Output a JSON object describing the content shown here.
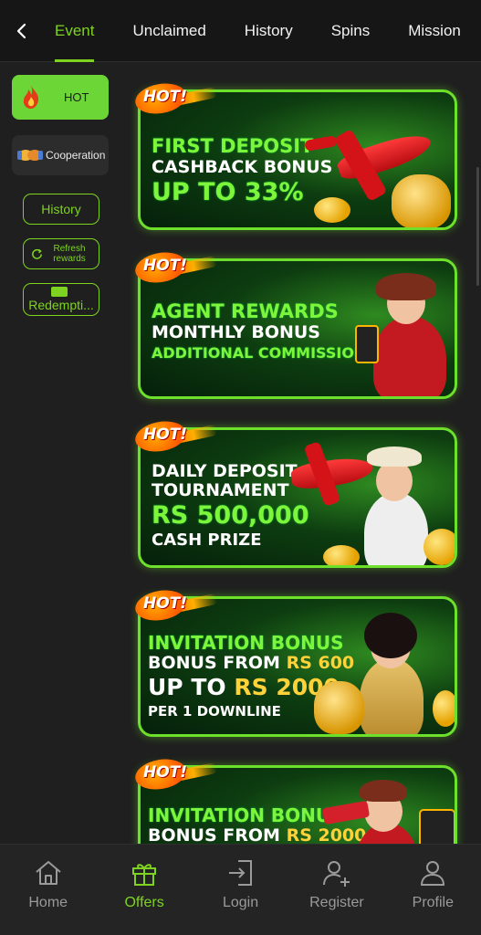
{
  "topbar": {
    "tabs": [
      {
        "label": "Event",
        "active": true
      },
      {
        "label": "Unclaimed",
        "active": false
      },
      {
        "label": "History",
        "active": false
      },
      {
        "label": "Spins",
        "active": false
      },
      {
        "label": "Mission",
        "active": false
      }
    ]
  },
  "sidebar": {
    "hot_label": "HOT",
    "cooperation_label": "Cooperation",
    "history_label": "History",
    "refresh_label": "Refresh rewards",
    "refresh_line1": "Refresh",
    "refresh_line2": "rewards",
    "redemption_label": "Redempti..."
  },
  "banners": [
    {
      "badge": "HOT!",
      "lines": [
        "FIRST DEPOSIT",
        "CASHBACK BONUS",
        "UP TO 33%"
      ]
    },
    {
      "badge": "HOT!",
      "lines": [
        "AGENT REWARDS",
        "MONTHLY BONUS",
        "ADDITIONAL COMMISSIONS"
      ]
    },
    {
      "badge": "HOT!",
      "lines": [
        "DAILY DEPOSIT",
        "TOURNAMENT",
        "Rs 500,000",
        "CASH PRIZE"
      ]
    },
    {
      "badge": "HOT!",
      "lines": [
        "INVITATION BONUS",
        "BONUS FROM",
        "Rs 600",
        "UP TO",
        "Rs 2000",
        "PER 1 DOWNLINE"
      ]
    },
    {
      "badge": "HOT!",
      "lines": [
        "INVITATION BONUS",
        "BONUS FROM",
        "Rs 2000"
      ]
    }
  ],
  "bottom_nav": [
    {
      "label": "Home",
      "icon": "home-icon",
      "active": false
    },
    {
      "label": "Offers",
      "icon": "gift-icon",
      "active": true
    },
    {
      "label": "Login",
      "icon": "login-icon",
      "active": false
    },
    {
      "label": "Register",
      "icon": "add-user-icon",
      "active": false
    },
    {
      "label": "Profile",
      "icon": "user-icon",
      "active": false
    }
  ],
  "colors": {
    "accent": "#7ed321",
    "background": "#1f1f1f",
    "banner_border": "#6ce02a"
  }
}
